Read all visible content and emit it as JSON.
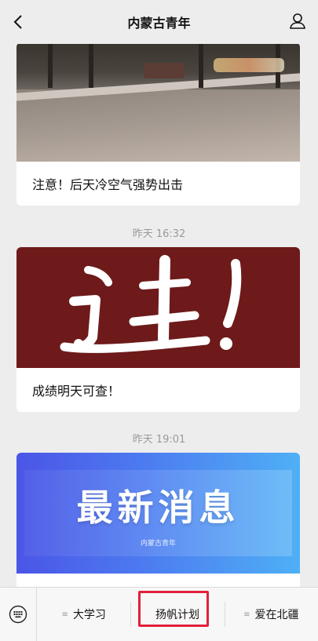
{
  "header": {
    "title": "内蒙古青年"
  },
  "feed": {
    "cards": [
      {
        "caption": "注意！后天冷空气强势出击"
      },
      {
        "caption": "成绩明天可查！"
      },
      {
        "caption": "",
        "banner_text": "最新消息",
        "logo_text": "内蒙古青年"
      }
    ],
    "times": [
      "昨天 16:32",
      "昨天 19:01"
    ]
  },
  "menu": {
    "items": [
      {
        "label": "大学习",
        "has_submenu": true
      },
      {
        "label": "扬帆计划",
        "has_submenu": false
      },
      {
        "label": "爱在北疆",
        "has_submenu": true
      }
    ]
  },
  "colors": {
    "highlight": "#e2203b",
    "red_banner": "#6e1a1a",
    "grad_start": "#4b55e6",
    "grad_end": "#4fb0f6"
  }
}
